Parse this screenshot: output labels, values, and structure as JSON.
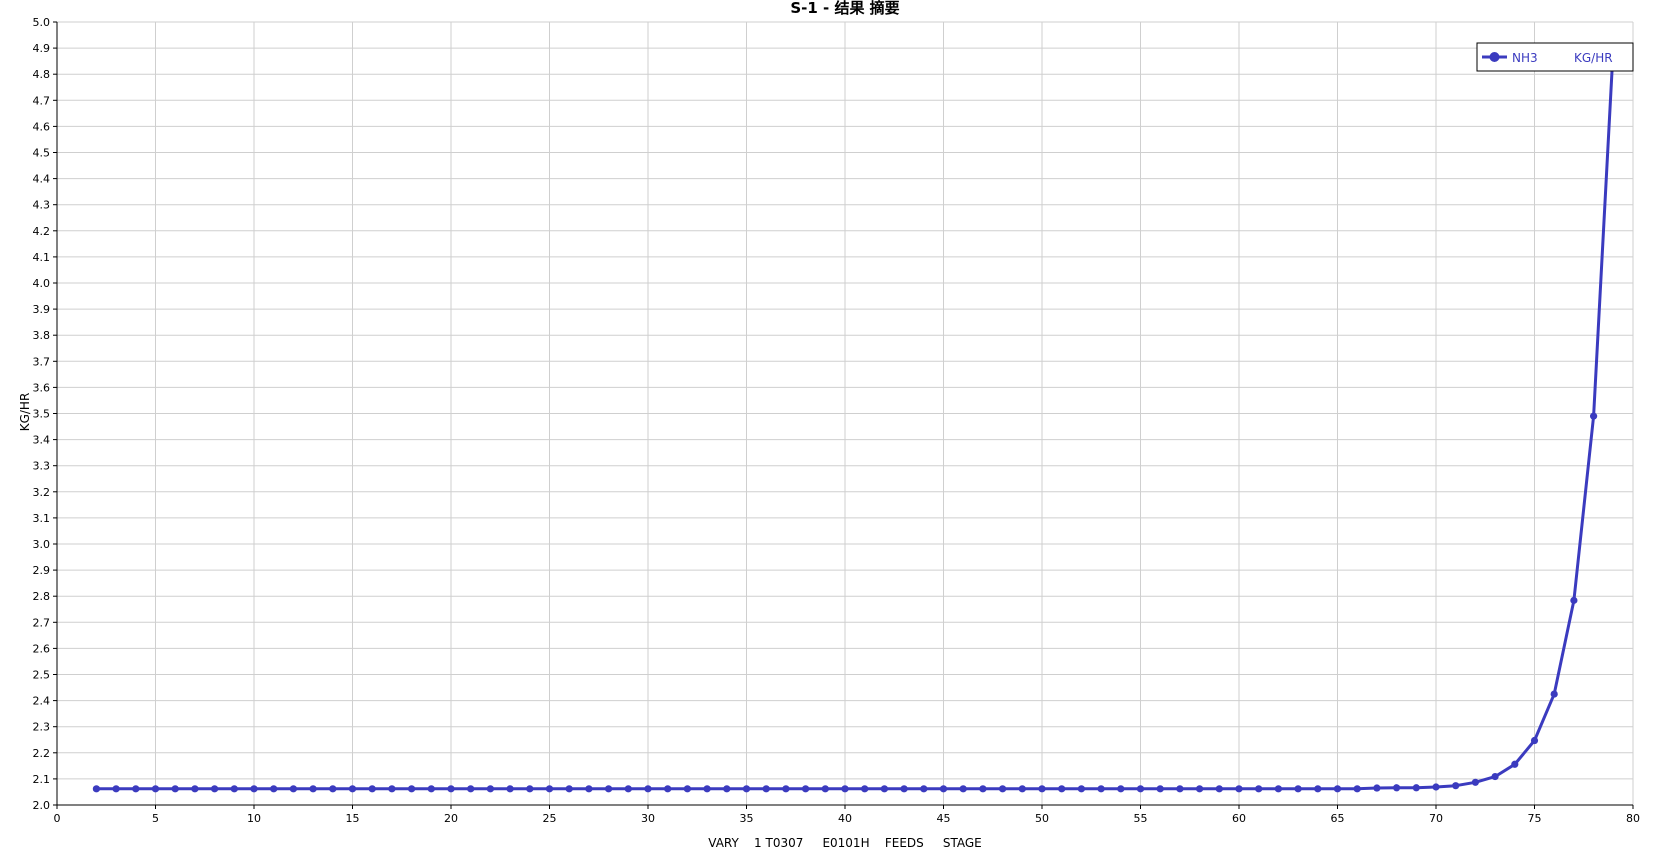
{
  "colors": {
    "series": "#3b3bbf",
    "grid": "#cfcfcf",
    "axis": "#000000",
    "background": "#ffffff",
    "legend_border": "#000000"
  },
  "chart_data": {
    "type": "line",
    "title": "S-1 - 结果 摘要",
    "xlabel": "VARY    1 T0307     E0101H    FEEDS     STAGE",
    "ylabel": "KG/HR",
    "xlim": [
      0,
      80
    ],
    "ylim": [
      2.0,
      5.0
    ],
    "x_ticks": [
      0,
      5,
      10,
      15,
      20,
      25,
      30,
      35,
      40,
      45,
      50,
      55,
      60,
      65,
      70,
      75,
      80
    ],
    "y_ticks": [
      2.0,
      2.1,
      2.2,
      2.3,
      2.4,
      2.5,
      2.6,
      2.7,
      2.8,
      2.9,
      3.0,
      3.1,
      3.2,
      3.3,
      3.4,
      3.5,
      3.6,
      3.7,
      3.8,
      3.9,
      4.0,
      4.1,
      4.2,
      4.3,
      4.4,
      4.5,
      4.6,
      4.7,
      4.8,
      4.9,
      5.0
    ],
    "grid": true,
    "legend": {
      "placement": "top-right",
      "entries": [
        {
          "label": "NH3",
          "unit": "KG/HR"
        }
      ]
    },
    "series": [
      {
        "name": "NH3",
        "unit": "KG/HR",
        "x": [
          2,
          3,
          4,
          5,
          6,
          7,
          8,
          9,
          10,
          11,
          12,
          13,
          14,
          15,
          16,
          17,
          18,
          19,
          20,
          21,
          22,
          23,
          24,
          25,
          26,
          27,
          28,
          29,
          30,
          31,
          32,
          33,
          34,
          35,
          36,
          37,
          38,
          39,
          40,
          41,
          42,
          43,
          44,
          45,
          46,
          47,
          48,
          49,
          50,
          51,
          52,
          53,
          54,
          55,
          56,
          57,
          58,
          59,
          60,
          61,
          62,
          63,
          64,
          65,
          66,
          67,
          68,
          69,
          70,
          71,
          72,
          73,
          74,
          75,
          76,
          77,
          78,
          79
        ],
        "values": [
          2.062,
          2.062,
          2.062,
          2.062,
          2.062,
          2.062,
          2.062,
          2.062,
          2.062,
          2.062,
          2.062,
          2.062,
          2.062,
          2.062,
          2.062,
          2.062,
          2.062,
          2.062,
          2.062,
          2.062,
          2.062,
          2.062,
          2.062,
          2.062,
          2.062,
          2.062,
          2.062,
          2.062,
          2.062,
          2.062,
          2.062,
          2.062,
          2.062,
          2.062,
          2.062,
          2.062,
          2.062,
          2.062,
          2.062,
          2.062,
          2.062,
          2.062,
          2.062,
          2.062,
          2.062,
          2.062,
          2.062,
          2.062,
          2.062,
          2.062,
          2.062,
          2.062,
          2.062,
          2.062,
          2.062,
          2.062,
          2.062,
          2.062,
          2.062,
          2.062,
          2.062,
          2.062,
          2.062,
          2.062,
          2.062,
          2.065,
          2.066,
          2.066,
          2.069,
          2.074,
          2.087,
          2.109,
          2.156,
          2.247,
          2.425,
          2.784,
          3.49,
          4.905
        ]
      }
    ]
  }
}
